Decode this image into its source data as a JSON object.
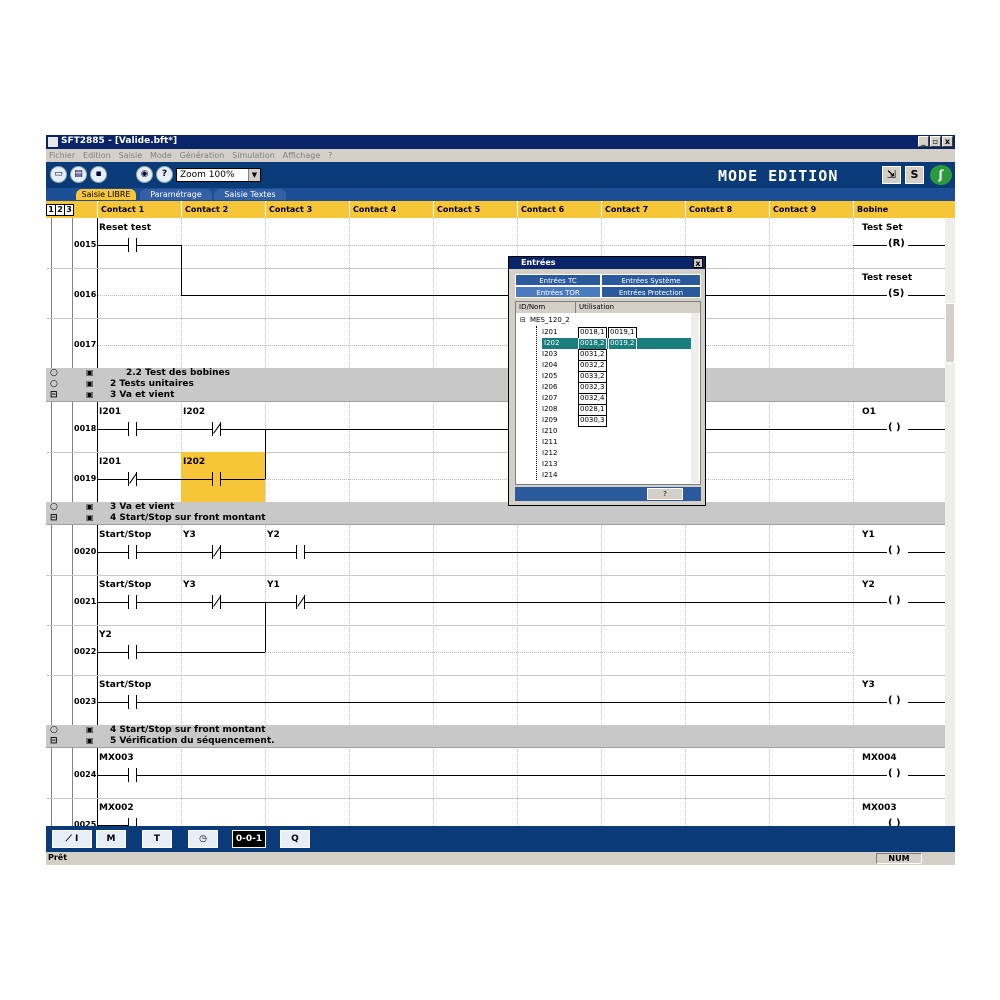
{
  "window": {
    "title": "SFT2885 - [Valide.bft*]",
    "minimize": "_",
    "restore": "▫",
    "close": "x"
  },
  "menu": [
    "Fichier",
    "Edition",
    "Saisie",
    "Mode",
    "Génération",
    "Simulation",
    "Affichage",
    "?"
  ],
  "toolbar": {
    "zoom": "Zoom 100%",
    "mode_label": "MODE EDITION",
    "help": "?",
    "s_button": "S"
  },
  "tabs": [
    "Saisie LIBRE",
    "Paramétrage",
    "Saisie Textes"
  ],
  "level_buttons": [
    "1",
    "2",
    "3"
  ],
  "columns": [
    "Contact 1",
    "Contact 2",
    "Contact 3",
    "Contact 4",
    "Contact 5",
    "Contact 6",
    "Contact 7",
    "Contact 8",
    "Contact 9",
    "Bobine"
  ],
  "rungs": [
    {
      "num": "0015",
      "labels": [
        "Reset test"
      ],
      "coil_label": "Test Set",
      "coil": "(R)"
    },
    {
      "num": "0016",
      "labels": [],
      "coil_label": "Test reset",
      "coil": "(S)"
    },
    {
      "num": "0017",
      "labels": [],
      "coil_label": "",
      "coil": ""
    },
    {
      "num": "0018",
      "labels": [
        "I201",
        "I202"
      ],
      "coil_label": "O1",
      "coil": "( )"
    },
    {
      "num": "0019",
      "labels": [
        "I201",
        "I202"
      ],
      "coil_label": "",
      "coil": ""
    },
    {
      "num": "0020",
      "labels": [
        "Start/Stop",
        "Y3",
        "Y2"
      ],
      "coil_label": "Y1",
      "coil": "( )"
    },
    {
      "num": "0021",
      "labels": [
        "Start/Stop",
        "Y3",
        "Y1"
      ],
      "coil_label": "Y2",
      "coil": "( )"
    },
    {
      "num": "0022",
      "labels": [
        "Y2"
      ],
      "coil_label": "",
      "coil": ""
    },
    {
      "num": "0023",
      "labels": [
        "Start/Stop"
      ],
      "coil_label": "Y3",
      "coil": "( )"
    },
    {
      "num": "0024",
      "labels": [
        "MX003"
      ],
      "coil_label": "MX004",
      "coil": "( )"
    },
    {
      "num": "0025",
      "labels": [
        "MX002"
      ],
      "coil_label": "MX003",
      "coil": "( )"
    }
  ],
  "sections": [
    {
      "title": "2.2 Test des bobines"
    },
    {
      "title": "2 Tests unitaires"
    },
    {
      "title": "3 Va et vient"
    },
    {
      "title": "3 Va et vient"
    },
    {
      "title": "4 Start/Stop sur front montant"
    },
    {
      "title": "4 Start/Stop sur front montant"
    },
    {
      "title": "5 Vérification du séquencement."
    }
  ],
  "dialog": {
    "title": "Entrées",
    "close": "x",
    "tabs": [
      "Entrées TC",
      "Entrées Système",
      "Entrées TOR",
      "Entrées Protection"
    ],
    "headers": [
      "ID/Nom",
      "Utilisation"
    ],
    "root": "MES_120_2",
    "rows": [
      {
        "id": "I201",
        "uses": [
          "0018,1",
          "0019,1"
        ]
      },
      {
        "id": "I202",
        "uses": [
          "0018,2",
          "0019,2"
        ]
      },
      {
        "id": "I203",
        "uses": [
          "0031,2"
        ]
      },
      {
        "id": "I204",
        "uses": [
          "0032,2"
        ]
      },
      {
        "id": "I205",
        "uses": [
          "0033,2"
        ]
      },
      {
        "id": "I206",
        "uses": [
          "0032,3"
        ]
      },
      {
        "id": "I207",
        "uses": [
          "0032,4"
        ]
      },
      {
        "id": "I208",
        "uses": [
          "0028,1"
        ]
      },
      {
        "id": "I209",
        "uses": [
          "0030,3"
        ]
      },
      {
        "id": "I210",
        "uses": []
      },
      {
        "id": "I211",
        "uses": []
      },
      {
        "id": "I212",
        "uses": []
      },
      {
        "id": "I213",
        "uses": []
      },
      {
        "id": "I214",
        "uses": []
      }
    ],
    "help": "?"
  },
  "bottom_tools": [
    "M",
    "T",
    "0-0-1",
    "Q"
  ],
  "status": {
    "ready": "Prêt",
    "num": "NUM"
  }
}
